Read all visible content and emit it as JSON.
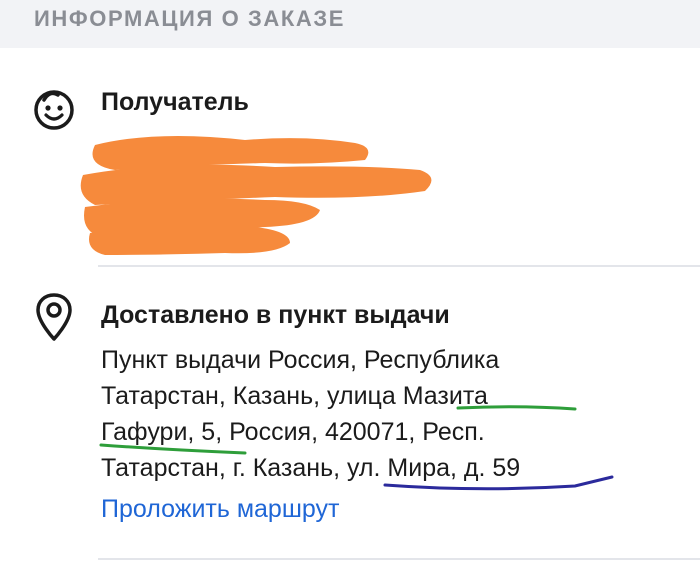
{
  "section_title": "ИНФОРМАЦИЯ О ЗАКАЗЕ",
  "recipient": {
    "label": "Получатель",
    "icon": "smiley-icon"
  },
  "delivery": {
    "status": "Доставлено в пункт выдачи",
    "icon": "location-pin-icon",
    "address_lines": [
      "Пункт выдачи Россия, Республика",
      "Татарстан, Казань, улица Мазита",
      "Гафури, 5, Россия, 420071, Респ.",
      "Татарстан, г. Казань, ул. Мира, д. 59"
    ],
    "route_link": "Проложить маршрут"
  },
  "colors": {
    "accent_link": "#1f66d6",
    "redaction": "#f68a3c",
    "annotation_green": "#2e9e3a",
    "annotation_blue": "#2b2a9c"
  }
}
